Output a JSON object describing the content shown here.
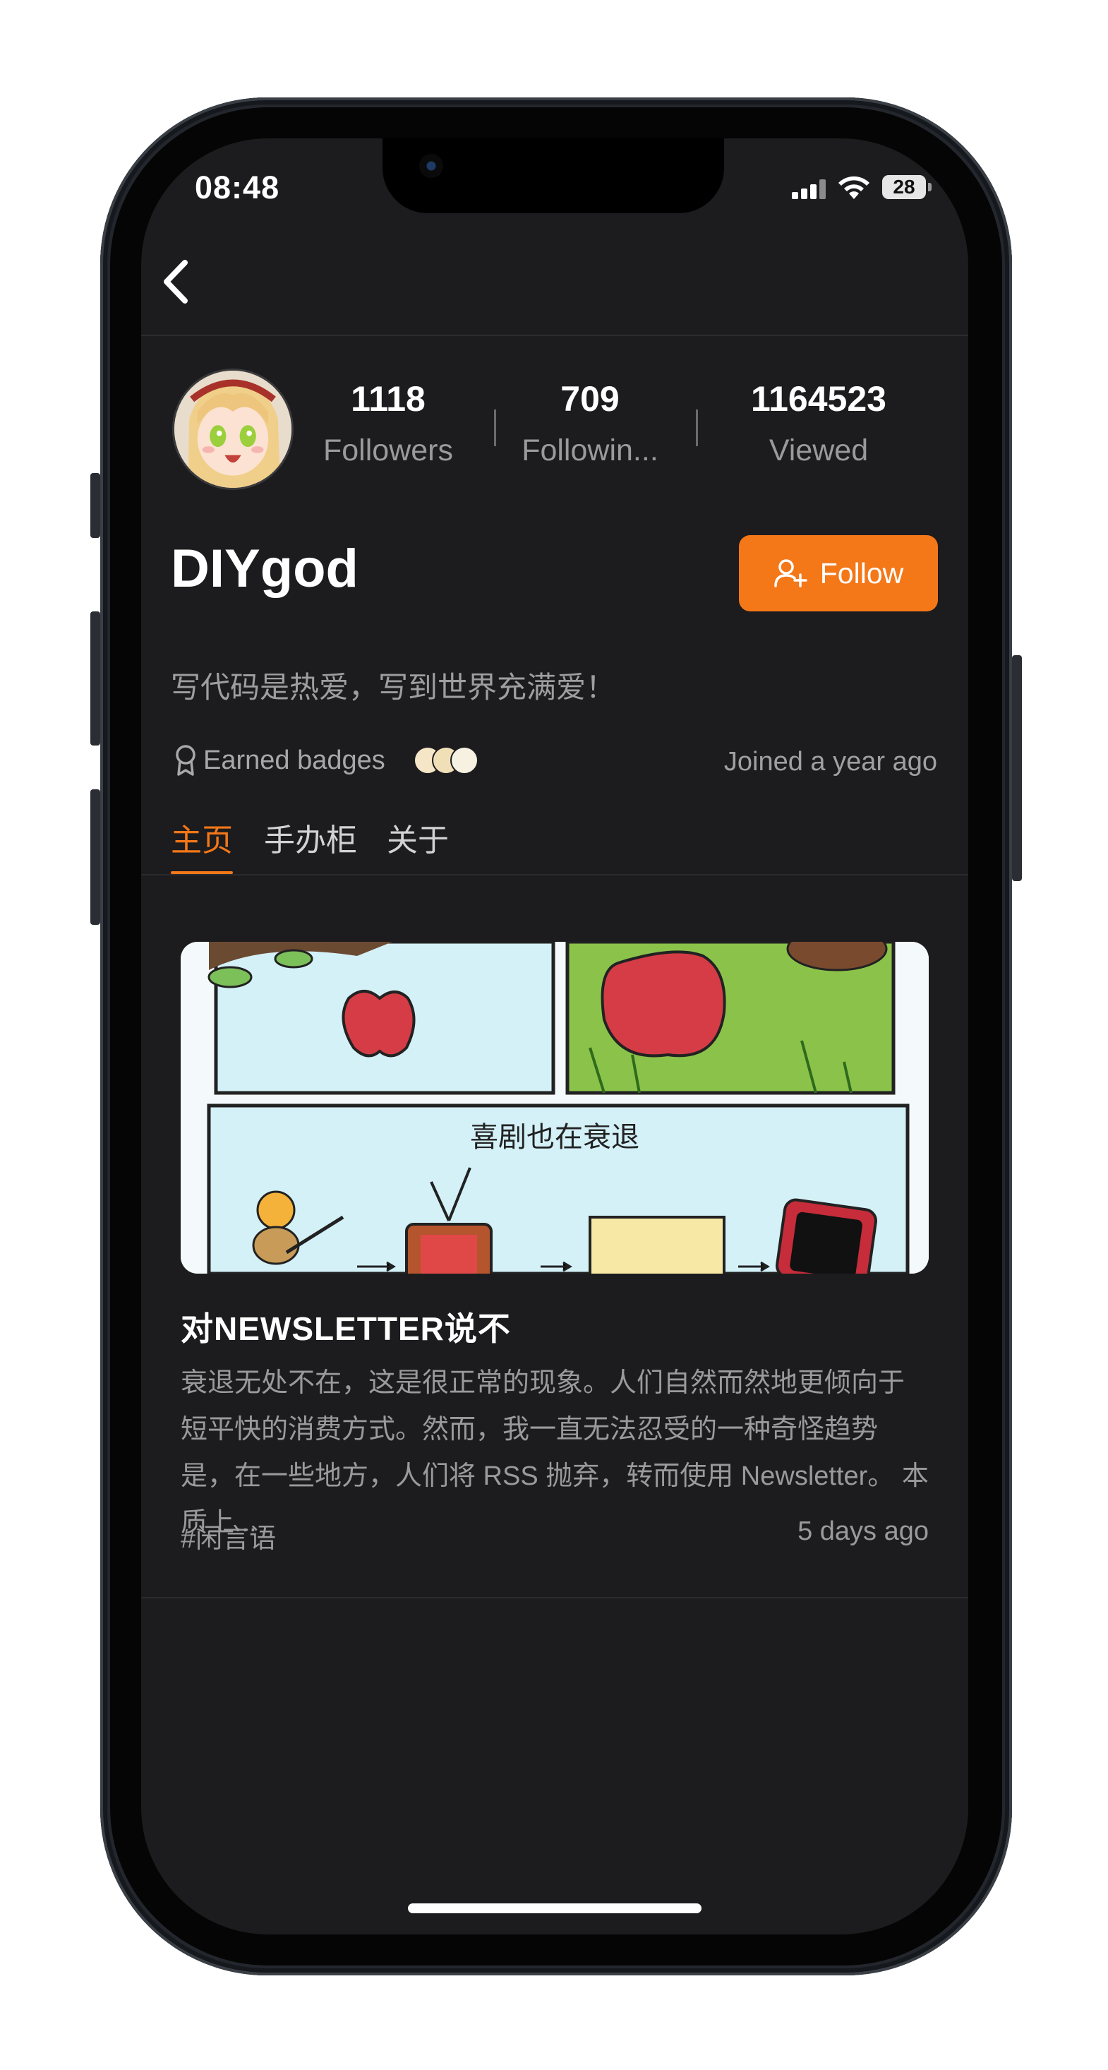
{
  "status_bar": {
    "time": "08:48",
    "battery": "28"
  },
  "profile": {
    "username": "DIYgod",
    "bio": "写代码是热爱，写到世界充满爱！",
    "stats": [
      {
        "value": "1118",
        "label": "Followers"
      },
      {
        "value": "709",
        "label": "Followin..."
      },
      {
        "value": "1164523",
        "label": "Viewed"
      }
    ],
    "follow_label": "Follow",
    "badges_label": "Earned badges",
    "joined": "Joined a year ago"
  },
  "tabs": [
    {
      "label": "主页",
      "active": true
    },
    {
      "label": "手办柜",
      "active": false
    },
    {
      "label": "关于",
      "active": false
    }
  ],
  "post": {
    "comic_caption": "喜剧也在衰退",
    "title": "对NEWSLETTER说不",
    "excerpt": "衰退无处不在，这是很正常的现象。人们自然而然地更倾向于短平快的消费方式。然而，我一直无法忍受的一种奇怪趋势是，在一些地方，人们将 RSS 抛弃，转而使用 Newsletter。 本质上...",
    "tag": "#闲言语",
    "time_ago": "5 days ago"
  },
  "colors": {
    "accent": "#f47718",
    "background": "#1c1c1e"
  }
}
